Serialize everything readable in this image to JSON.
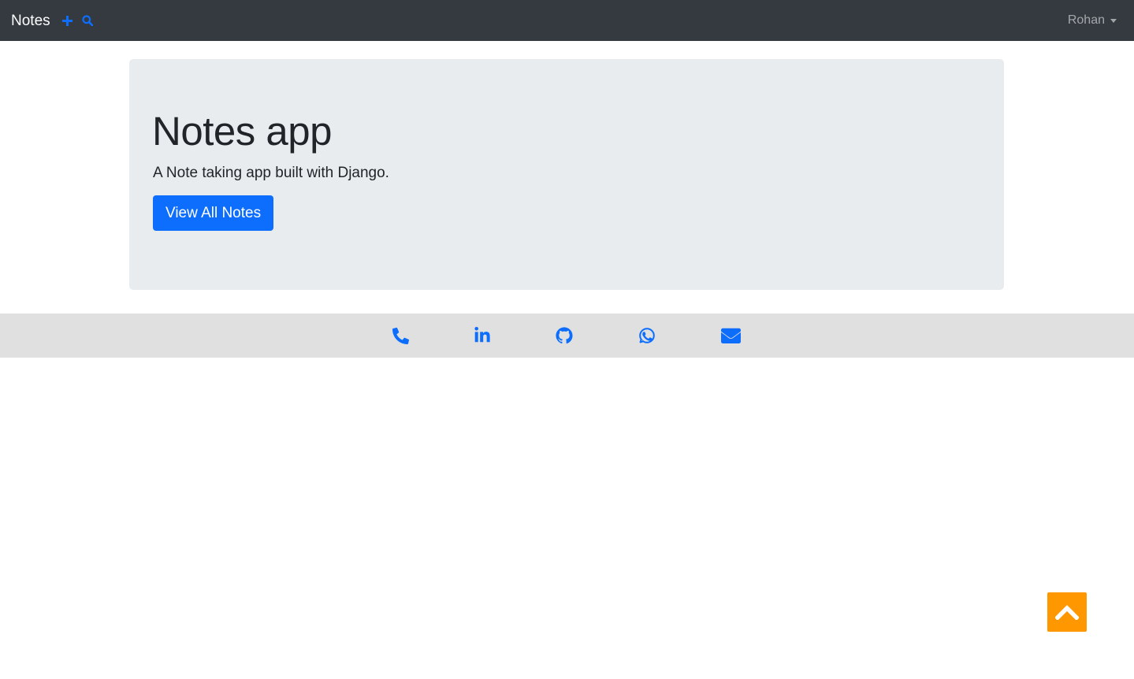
{
  "navbar": {
    "brand": "Notes",
    "add_icon": "plus-icon",
    "search_icon": "search-icon",
    "user_name": "Rohan"
  },
  "jumbotron": {
    "title": "Notes app",
    "lead": "A Note taking app built with Django.",
    "button_label": "View All Notes"
  },
  "footer": {
    "links": [
      {
        "icon": "phone-icon"
      },
      {
        "icon": "linkedin-icon"
      },
      {
        "icon": "github-icon"
      },
      {
        "icon": "whatsapp-icon"
      },
      {
        "icon": "envelope-icon"
      }
    ]
  },
  "back_to_top": {
    "icon": "chevron-up-icon"
  },
  "colors": {
    "navbar_bg": "#343a40",
    "primary": "#0d6efd",
    "jumbotron_bg": "#e9ecef",
    "footer_bg": "#e0e0e0",
    "back_to_top_bg": "#ff9800"
  }
}
